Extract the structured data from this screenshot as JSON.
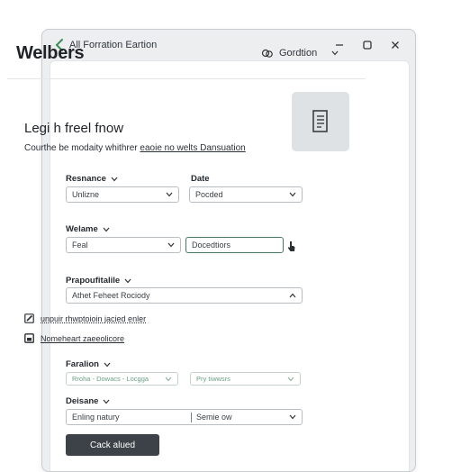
{
  "window": {
    "title": "All Forration Eartion"
  },
  "header": {
    "app_title": "Welbers",
    "action_label": "Gordtion"
  },
  "section": {
    "title": "Legi h freel fnow",
    "desc_text": "Courthe be modaity whithrer ",
    "desc_link": "eaoie no welts Dansuation"
  },
  "fields": {
    "response": {
      "label": "Resnance",
      "value": "Unlizne"
    },
    "date": {
      "label": "Date",
      "value": "Pocded"
    },
    "welame": {
      "label": "Welame",
      "value": "Feal"
    },
    "search": {
      "value": "Docedtiors"
    },
    "preparation": {
      "label": "Prapoufitalile",
      "value": "Athet Feheet Rociody"
    },
    "faration": {
      "label": "Faralion",
      "value_left": "Rroha - Dowacs - Locgga",
      "value_right": "Pry tiwwsrs"
    },
    "deisane": {
      "label": "Deisane",
      "value_left": "Enling natury",
      "value_right": "Semie ow"
    }
  },
  "checks": [
    {
      "label": "unpuir rhwptoioin jacied enler",
      "icon": "edit-icon"
    },
    {
      "label": "Nomeheart zaeeolicore",
      "icon": "checkbox-icon"
    }
  ],
  "actions": {
    "primary_label": "Cack alued"
  },
  "colors": {
    "accent": "#4a7a64",
    "button": "#3d4248",
    "window_bg": "#eceeef"
  }
}
